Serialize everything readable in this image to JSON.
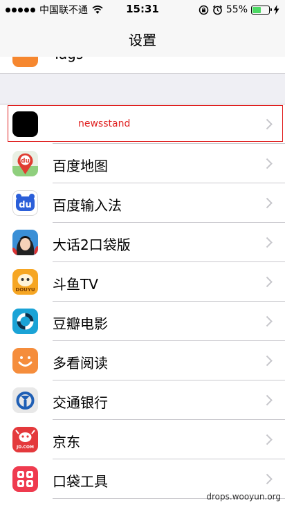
{
  "status_bar": {
    "carrier": "中国联不通",
    "time": "15:31",
    "battery_percent": "55%",
    "battery_level": 0.55,
    "battery_color": "#4cd964"
  },
  "nav": {
    "title": "设置"
  },
  "partial_row": {
    "label": "Tags"
  },
  "apps": [
    {
      "label": "newsstand",
      "icon": "newsstand-icon",
      "highlighted": true
    },
    {
      "label": "百度地图",
      "icon": "baidu-map-icon"
    },
    {
      "label": "百度输入法",
      "icon": "baidu-input-icon"
    },
    {
      "label": "大话2口袋版",
      "icon": "dahua2-icon"
    },
    {
      "label": "斗鱼TV",
      "icon": "douyu-icon"
    },
    {
      "label": "豆瓣电影",
      "icon": "douban-movie-icon"
    },
    {
      "label": "多看阅读",
      "icon": "duokan-icon"
    },
    {
      "label": "交通银行",
      "icon": "bankcomm-icon"
    },
    {
      "label": "京东",
      "icon": "jd-icon"
    },
    {
      "label": "口袋工具",
      "icon": "pocket-tools-icon"
    }
  ],
  "icon_texts": {
    "baidu_map": "du",
    "baidu_input": "du",
    "douyu": "DOUYU",
    "jd": "JD.COM"
  },
  "highlight_color": "#e02020",
  "watermark": "drops.wooyun.org"
}
